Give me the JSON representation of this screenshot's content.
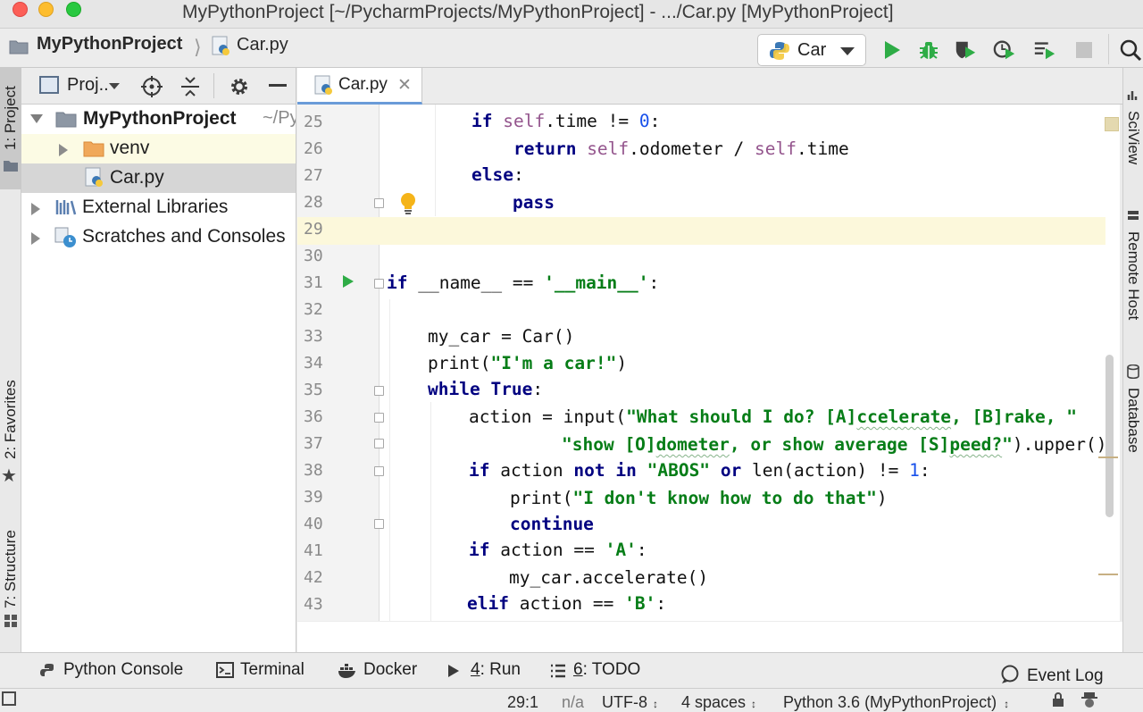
{
  "window": {
    "title": "MyPythonProject [~/PycharmProjects/MyPythonProject] - .../Car.py [MyPythonProject]"
  },
  "navbar": {
    "project": "MyPythonProject",
    "file": "Car.py",
    "run_config": "Car"
  },
  "left_stripe": {
    "project_tab": "1: Project",
    "favorites_tab": "2: Favorites",
    "structure_tab": "7: Structure"
  },
  "project_panel": {
    "view_label": "Proj..",
    "tree": [
      {
        "label": "MyPythonProject",
        "suffix": "~/Py",
        "expanded": true
      },
      {
        "label": "venv",
        "expanded": false
      },
      {
        "label": "Car.py"
      },
      {
        "label": "External Libraries",
        "expanded": false
      },
      {
        "label": "Scratches and Consoles",
        "expanded": false
      }
    ]
  },
  "editor": {
    "tab": "Car.py",
    "caret_line": 29,
    "lines": [
      25,
      26,
      27,
      28,
      29,
      30,
      31,
      32,
      33,
      34,
      35,
      36,
      37,
      38,
      39,
      40,
      41,
      42,
      43
    ],
    "code": {
      "l25": [
        "if",
        " self",
        ".time != ",
        "0",
        ":"
      ],
      "l26": [
        "return",
        " self",
        ".odometer / ",
        "self",
        ".time"
      ],
      "l27": [
        "else",
        ":"
      ],
      "l28": [
        "pass"
      ],
      "l31": [
        "if",
        " __name__ == ",
        "'__main__'",
        ":"
      ],
      "l33": "my_car = Car()",
      "l34": [
        "print(",
        "\"I'm a car!\"",
        ")"
      ],
      "l35": [
        "while",
        " ",
        "True",
        ":"
      ],
      "l36": [
        "action = input(",
        "\"What should I do? [A]",
        "ccelerate",
        ", [B]rake, \""
      ],
      "l37": [
        "\"show [O]",
        "dometer",
        ", or show average [S]",
        "peed?",
        "\"",
        ").upper()"
      ],
      "l38": [
        "if",
        " action ",
        "not in",
        " ",
        "\"ABOS\"",
        " ",
        "or",
        " len(action) != ",
        "1",
        ":"
      ],
      "l39": [
        "print(",
        "\"I don't know how to do that\"",
        ")"
      ],
      "l40": [
        "continue"
      ],
      "l41": [
        "if",
        " action == ",
        "'A'",
        ":"
      ],
      "l42": "my_car.accelerate()",
      "l43": [
        "elif",
        " action == ",
        "'B'",
        ":"
      ]
    }
  },
  "right_stripe": {
    "sciview": "SciView",
    "remote_host": "Remote Host",
    "database": "Database"
  },
  "toolwindows": {
    "python_console": "Python Console",
    "terminal": "Terminal",
    "docker": "Docker",
    "run_num": "4",
    "run": ": Run",
    "todo_num": "6",
    "todo": ": TODO",
    "event_log": "Event Log"
  },
  "status": {
    "position": "29:1",
    "na": "n/a",
    "encoding": "UTF-8",
    "indent": "4 spaces",
    "interpreter": "Python 3.6 (MyPythonProject)"
  },
  "colors": {
    "keyword": "#000080",
    "self": "#94558d",
    "number": "#1750eb",
    "string": "#067d17",
    "caret_line": "#fcf8db",
    "run_green": "#2eac46"
  }
}
